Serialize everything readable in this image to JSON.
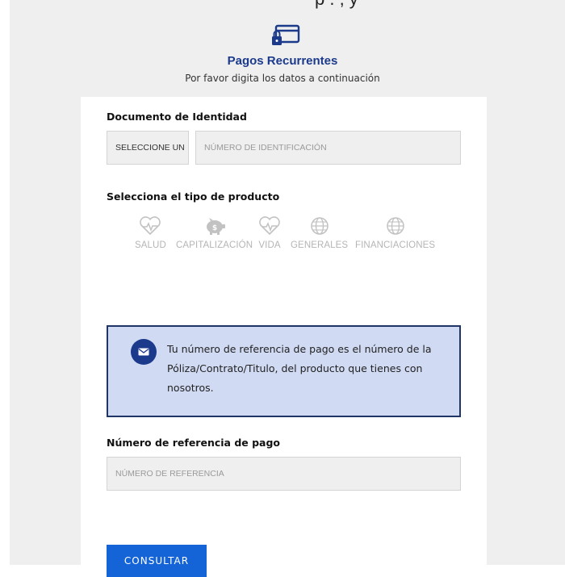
{
  "header": {
    "partial_top_text": "p  .  , y",
    "icon": "card-lock-icon",
    "title": "Pagos Recurrentes",
    "subtitle": "Por favor digita los datos a continuación"
  },
  "form": {
    "document_label": "Documento de Identidad",
    "document_type_value": "SELECCIONE UN",
    "document_number_placeholder": "NÚMERO DE IDENTIFICACIÓN",
    "product_label": "Selecciona el tipo de producto",
    "products": [
      {
        "label": "SALUD",
        "icon": "heart-pulse-icon"
      },
      {
        "label": "CAPITALIZACIÓN",
        "icon": "piggy-bank-icon"
      },
      {
        "label": "VIDA",
        "icon": "heart-pulse-icon"
      },
      {
        "label": "GENERALES",
        "icon": "globe-icon"
      },
      {
        "label": "FINANCIACIONES",
        "icon": "globe-icon"
      }
    ],
    "info_icon": "envelope-icon",
    "info_text": "Tu número de referencia de pago es el número de la Póliza/Contrato/Titulo, del producto que tienes con nosotros.",
    "reference_label": "Número de referencia de pago",
    "reference_placeholder": "NÚMERO DE REFERENCIA",
    "submit_label": "CONSULTAR"
  },
  "colors": {
    "brand_blue": "#1b3a8c",
    "button_blue": "#1464d8",
    "info_bg": "#d0daf3",
    "page_bg": "#efefef",
    "muted_icon": "#c2c2c2"
  }
}
